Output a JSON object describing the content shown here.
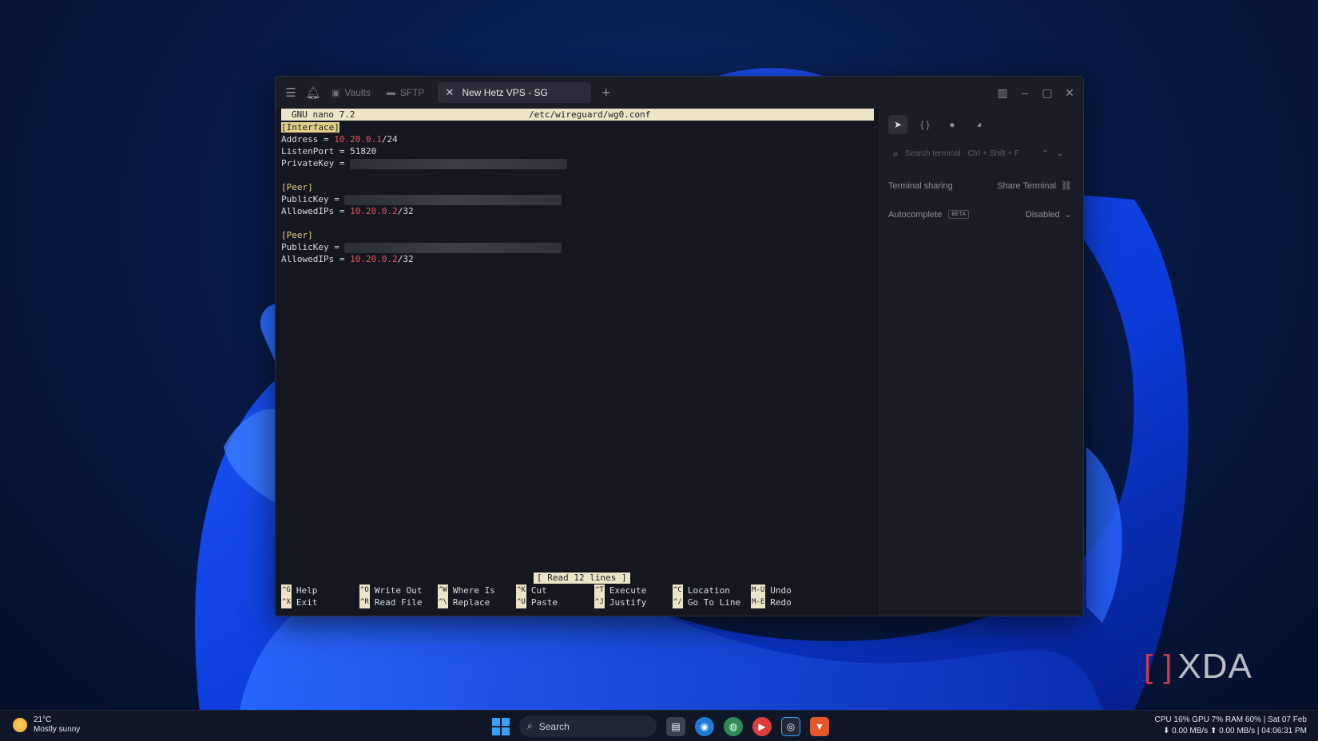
{
  "window": {
    "tabs": {
      "vaults": "Vaults",
      "sftp": "SFTP",
      "active": "New Hetz VPS - SG"
    }
  },
  "nano": {
    "version": "GNU nano 7.2",
    "file": "/etc/wireguard/wg0.conf",
    "lines": [
      {
        "type": "section",
        "text": "[Interface]"
      },
      {
        "type": "kv",
        "key": "Address = ",
        "ip": "10.20.0.1",
        "suffix": "/24"
      },
      {
        "type": "plain",
        "text": "ListenPort = 51820"
      },
      {
        "type": "redacted",
        "key": "PrivateKey = "
      },
      {
        "type": "blank"
      },
      {
        "type": "section",
        "text": "[Peer]"
      },
      {
        "type": "redacted",
        "key": "PublicKey = "
      },
      {
        "type": "kv",
        "key": "AllowedIPs = ",
        "ip": "10.20.0.2",
        "suffix": "/32"
      },
      {
        "type": "blank"
      },
      {
        "type": "section",
        "text": "[Peer]"
      },
      {
        "type": "redacted",
        "key": "PublicKey = "
      },
      {
        "type": "kv",
        "key": "AllowedIPs = ",
        "ip": "10.20.0.2",
        "suffix": "/32"
      }
    ],
    "status": "[ Read 12 lines ]",
    "shortcuts": [
      {
        "key": "^G",
        "label": "Help"
      },
      {
        "key": "^X",
        "label": "Exit"
      },
      {
        "key": "^O",
        "label": "Write Out"
      },
      {
        "key": "^R",
        "label": "Read File"
      },
      {
        "key": "^W",
        "label": "Where Is"
      },
      {
        "key": "^\\",
        "label": "Replace"
      },
      {
        "key": "^K",
        "label": "Cut"
      },
      {
        "key": "^U",
        "label": "Paste"
      },
      {
        "key": "^T",
        "label": "Execute"
      },
      {
        "key": "^J",
        "label": "Justify"
      },
      {
        "key": "^C",
        "label": "Location"
      },
      {
        "key": "^/",
        "label": "Go To Line"
      },
      {
        "key": "M-U",
        "label": "Undo"
      },
      {
        "key": "M-E",
        "label": "Redo"
      }
    ]
  },
  "panel": {
    "search_placeholder": "Search terminal · Ctrl + Shift + F",
    "sharing_label": "Terminal sharing",
    "sharing_action": "Share Terminal",
    "autocomplete_label": "Autocomplete",
    "beta": "BETA",
    "autocomplete_value": "Disabled"
  },
  "watermark": "XDA",
  "taskbar": {
    "temp": "21°C",
    "weather": "Mostly sunny",
    "search": "Search",
    "sys_line1": "CPU 16% GPU   7% RAM 60% | Sat 07 Feb",
    "sys_line2": "⬇ 0.00 MB/s ⬆ 0.00 MB/s | 04:06:31 PM"
  },
  "colors": {
    "accent": "#3aa0ff",
    "ip": "#e0575b",
    "section": "#e5d27a",
    "nano_bar": "#ece5c8"
  }
}
